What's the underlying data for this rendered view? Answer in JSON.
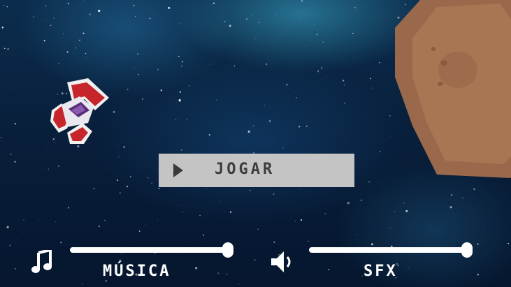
{
  "play_button": {
    "label": "JOGAR"
  },
  "music": {
    "label": "MÚSICA",
    "level": 1.0,
    "icon": "music-note-icon"
  },
  "sfx": {
    "label": "SFX",
    "level": 1.0,
    "icon": "speaker-icon"
  },
  "colors": {
    "button_bg": "#c4c4c4",
    "button_text": "#3d3d3d",
    "asteroid": "#9c6a4c",
    "ship_red": "#c6262b"
  }
}
